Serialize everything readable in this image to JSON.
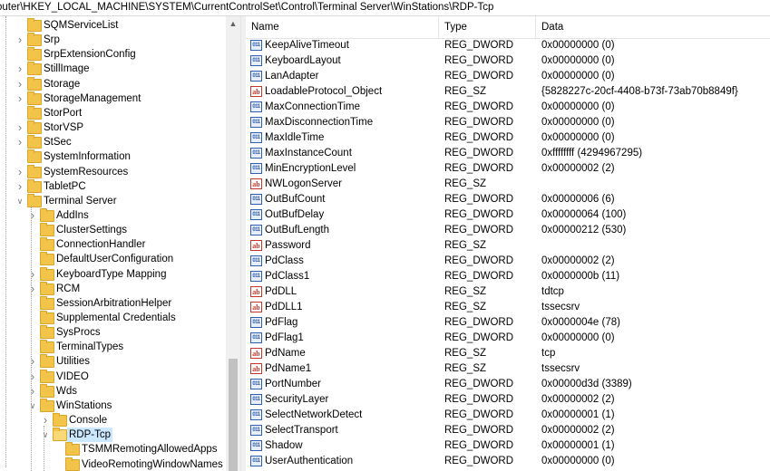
{
  "address": "outer\\HKEY_LOCAL_MACHINE\\SYSTEM\\CurrentControlSet\\Control\\Terminal Server\\WinStations\\RDP-Tcp",
  "tree": {
    "items": [
      {
        "label": "SQMServiceList",
        "level": 0,
        "expander": "",
        "selected": false
      },
      {
        "label": "Srp",
        "level": 0,
        "expander": ">",
        "selected": false
      },
      {
        "label": "SrpExtensionConfig",
        "level": 0,
        "expander": "",
        "selected": false
      },
      {
        "label": "StillImage",
        "level": 0,
        "expander": ">",
        "selected": false
      },
      {
        "label": "Storage",
        "level": 0,
        "expander": ">",
        "selected": false
      },
      {
        "label": "StorageManagement",
        "level": 0,
        "expander": ">",
        "selected": false
      },
      {
        "label": "StorPort",
        "level": 0,
        "expander": "",
        "selected": false
      },
      {
        "label": "StorVSP",
        "level": 0,
        "expander": ">",
        "selected": false
      },
      {
        "label": "StSec",
        "level": 0,
        "expander": ">",
        "selected": false
      },
      {
        "label": "SystemInformation",
        "level": 0,
        "expander": "",
        "selected": false
      },
      {
        "label": "SystemResources",
        "level": 0,
        "expander": ">",
        "selected": false
      },
      {
        "label": "TabletPC",
        "level": 0,
        "expander": ">",
        "selected": false
      },
      {
        "label": "Terminal Server",
        "level": 0,
        "expander": "v",
        "selected": false
      },
      {
        "label": "AddIns",
        "level": 1,
        "expander": ">",
        "selected": false
      },
      {
        "label": "ClusterSettings",
        "level": 1,
        "expander": "",
        "selected": false
      },
      {
        "label": "ConnectionHandler",
        "level": 1,
        "expander": "",
        "selected": false
      },
      {
        "label": "DefaultUserConfiguration",
        "level": 1,
        "expander": "",
        "selected": false
      },
      {
        "label": "KeyboardType Mapping",
        "level": 1,
        "expander": ">",
        "selected": false
      },
      {
        "label": "RCM",
        "level": 1,
        "expander": ">",
        "selected": false
      },
      {
        "label": "SessionArbitrationHelper",
        "level": 1,
        "expander": "",
        "selected": false
      },
      {
        "label": "Supplemental Credentials",
        "level": 1,
        "expander": "",
        "selected": false
      },
      {
        "label": "SysProcs",
        "level": 1,
        "expander": "",
        "selected": false
      },
      {
        "label": "TerminalTypes",
        "level": 1,
        "expander": "",
        "selected": false
      },
      {
        "label": "Utilities",
        "level": 1,
        "expander": ">",
        "selected": false
      },
      {
        "label": "VIDEO",
        "level": 1,
        "expander": ">",
        "selected": false
      },
      {
        "label": "Wds",
        "level": 1,
        "expander": ">",
        "selected": false
      },
      {
        "label": "WinStations",
        "level": 1,
        "expander": "v",
        "selected": false
      },
      {
        "label": "Console",
        "level": 2,
        "expander": ">",
        "selected": false
      },
      {
        "label": "RDP-Tcp",
        "level": 2,
        "expander": "v",
        "selected": true
      },
      {
        "label": "TSMMRemotingAllowedApps",
        "level": 3,
        "expander": "",
        "selected": false
      },
      {
        "label": "VideoRemotingWindowNames",
        "level": 3,
        "expander": "",
        "selected": false
      }
    ]
  },
  "list": {
    "columns": {
      "name": "Name",
      "type": "Type",
      "data": "Data"
    },
    "rows": [
      {
        "icon": "dword",
        "name": "KeepAliveTimeout",
        "type": "REG_DWORD",
        "data": "0x00000000 (0)"
      },
      {
        "icon": "dword",
        "name": "KeyboardLayout",
        "type": "REG_DWORD",
        "data": "0x00000000 (0)"
      },
      {
        "icon": "dword",
        "name": "LanAdapter",
        "type": "REG_DWORD",
        "data": "0x00000000 (0)"
      },
      {
        "icon": "sz",
        "name": "LoadableProtocol_Object",
        "type": "REG_SZ",
        "data": "{5828227c-20cf-4408-b73f-73ab70b8849f}"
      },
      {
        "icon": "dword",
        "name": "MaxConnectionTime",
        "type": "REG_DWORD",
        "data": "0x00000000 (0)"
      },
      {
        "icon": "dword",
        "name": "MaxDisconnectionTime",
        "type": "REG_DWORD",
        "data": "0x00000000 (0)"
      },
      {
        "icon": "dword",
        "name": "MaxIdleTime",
        "type": "REG_DWORD",
        "data": "0x00000000 (0)"
      },
      {
        "icon": "dword",
        "name": "MaxInstanceCount",
        "type": "REG_DWORD",
        "data": "0xffffffff (4294967295)"
      },
      {
        "icon": "dword",
        "name": "MinEncryptionLevel",
        "type": "REG_DWORD",
        "data": "0x00000002 (2)"
      },
      {
        "icon": "sz",
        "name": "NWLogonServer",
        "type": "REG_SZ",
        "data": ""
      },
      {
        "icon": "dword",
        "name": "OutBufCount",
        "type": "REG_DWORD",
        "data": "0x00000006 (6)"
      },
      {
        "icon": "dword",
        "name": "OutBufDelay",
        "type": "REG_DWORD",
        "data": "0x00000064 (100)"
      },
      {
        "icon": "dword",
        "name": "OutBufLength",
        "type": "REG_DWORD",
        "data": "0x00000212 (530)"
      },
      {
        "icon": "sz",
        "name": "Password",
        "type": "REG_SZ",
        "data": ""
      },
      {
        "icon": "dword",
        "name": "PdClass",
        "type": "REG_DWORD",
        "data": "0x00000002 (2)"
      },
      {
        "icon": "dword",
        "name": "PdClass1",
        "type": "REG_DWORD",
        "data": "0x0000000b (11)"
      },
      {
        "icon": "sz",
        "name": "PdDLL",
        "type": "REG_SZ",
        "data": "tdtcp"
      },
      {
        "icon": "sz",
        "name": "PdDLL1",
        "type": "REG_SZ",
        "data": "tssecsrv"
      },
      {
        "icon": "dword",
        "name": "PdFlag",
        "type": "REG_DWORD",
        "data": "0x0000004e (78)"
      },
      {
        "icon": "dword",
        "name": "PdFlag1",
        "type": "REG_DWORD",
        "data": "0x00000000 (0)"
      },
      {
        "icon": "sz",
        "name": "PdName",
        "type": "REG_SZ",
        "data": "tcp"
      },
      {
        "icon": "sz",
        "name": "PdName1",
        "type": "REG_SZ",
        "data": "tssecsrv"
      },
      {
        "icon": "dword",
        "name": "PortNumber",
        "type": "REG_DWORD",
        "data": "0x00000d3d (3389)"
      },
      {
        "icon": "dword",
        "name": "SecurityLayer",
        "type": "REG_DWORD",
        "data": "0x00000002 (2)"
      },
      {
        "icon": "dword",
        "name": "SelectNetworkDetect",
        "type": "REG_DWORD",
        "data": "0x00000001 (1)"
      },
      {
        "icon": "dword",
        "name": "SelectTransport",
        "type": "REG_DWORD",
        "data": "0x00000002 (2)"
      },
      {
        "icon": "dword",
        "name": "Shadow",
        "type": "REG_DWORD",
        "data": "0x00000001 (1)"
      },
      {
        "icon": "dword",
        "name": "UserAuthentication",
        "type": "REG_DWORD",
        "data": "0x00000000 (0)"
      }
    ]
  },
  "icons": {
    "sz_glyph": "ab",
    "dword_glyph": "011"
  },
  "colors": {
    "folder": "#f2c54a",
    "selection": "#cce8ff",
    "sz_icon": "#c0392b",
    "dword_icon": "#2f5fae"
  }
}
